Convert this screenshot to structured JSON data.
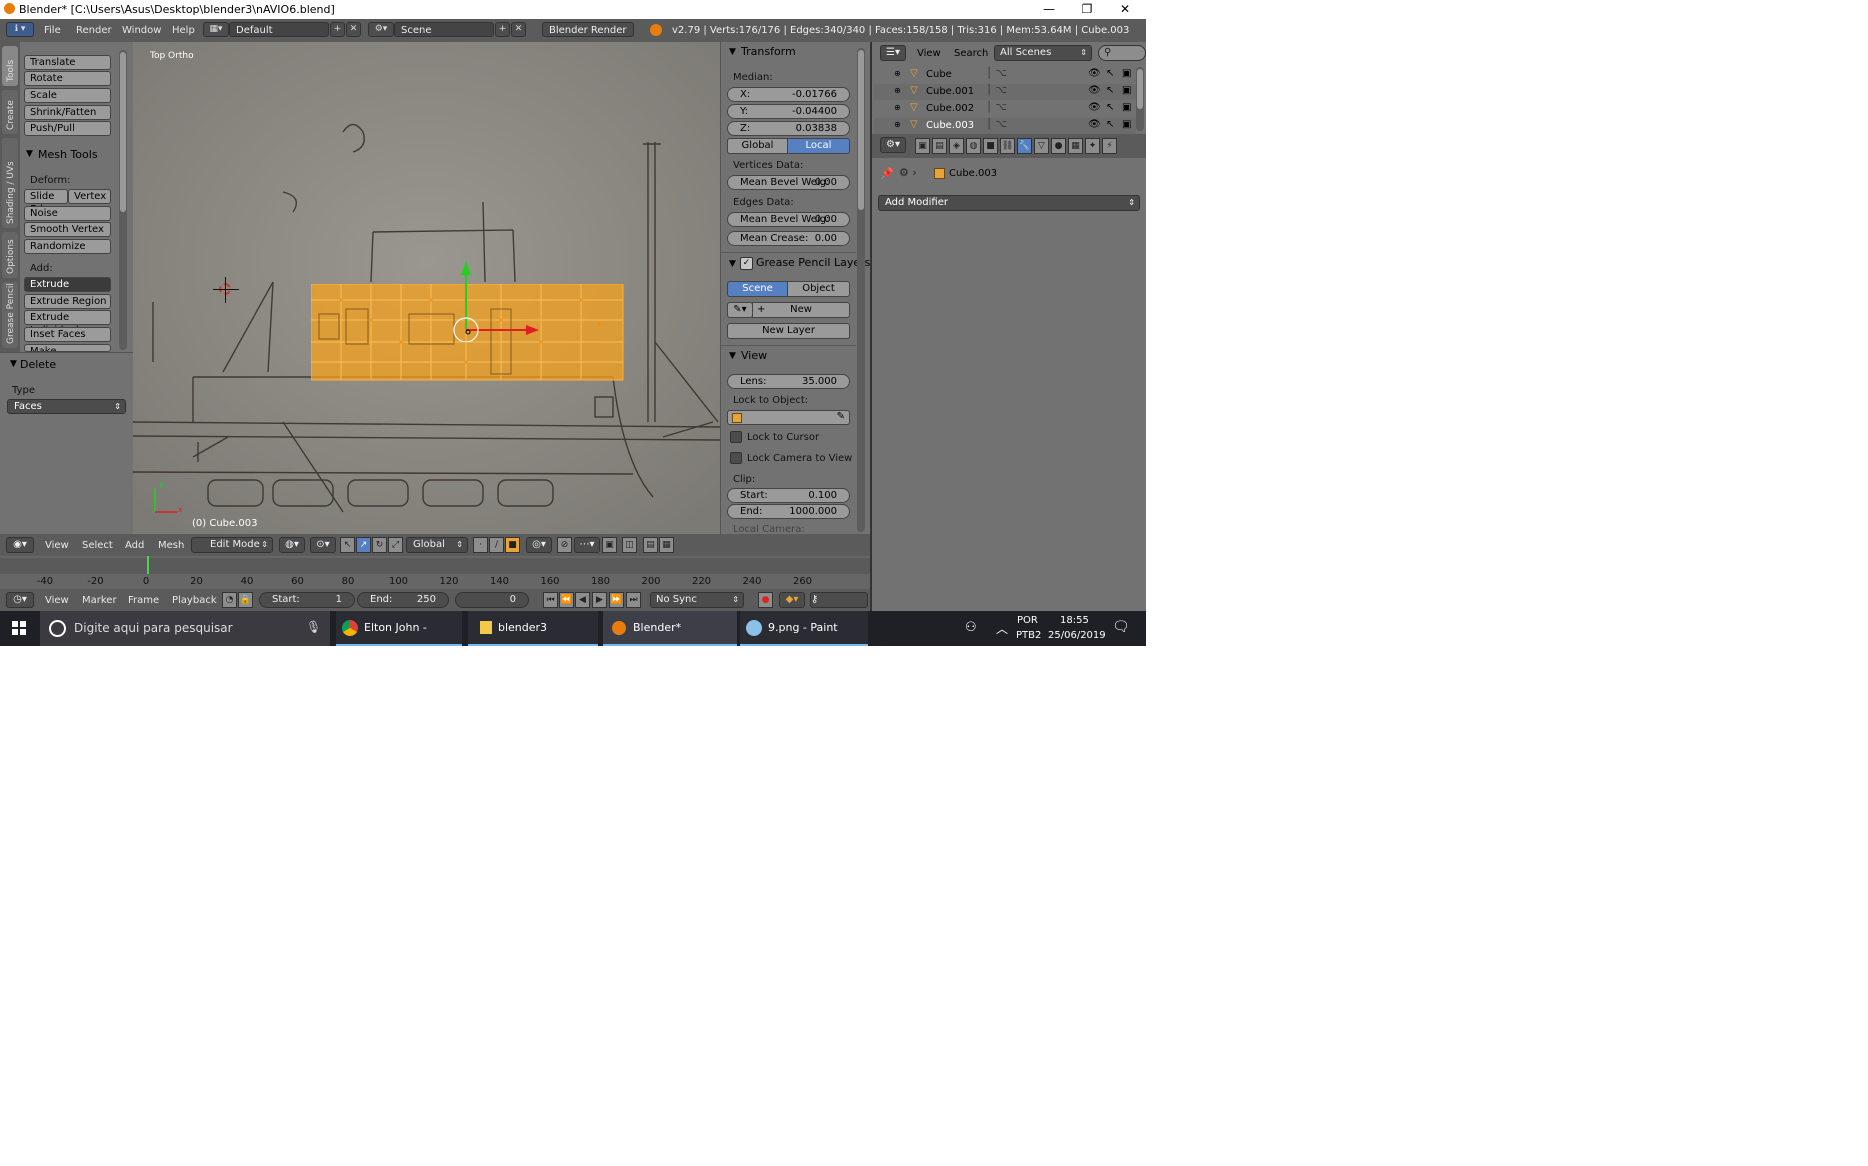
{
  "window": {
    "title": "Blender* [C:\\Users\\Asus\\Desktop\\blender3\\nAVIO6.blend]",
    "minimize": "—",
    "restore": "❐",
    "close": "✕"
  },
  "info_header": {
    "menus": [
      "File",
      "Render",
      "Window",
      "Help"
    ],
    "layout": "Default",
    "scene": "Scene",
    "engine": "Blender Render",
    "stats": "v2.79 | Verts:176/176 | Edges:340/340 | Faces:158/158 | Tris:316 | Mem:53.64M | Cube.003"
  },
  "tool_tabs": [
    "Tools",
    "Create",
    "Shading / UVs",
    "Options",
    "Grease Pencil"
  ],
  "tool_shelf": {
    "transform_buttons": [
      "Translate",
      "Rotate",
      "Scale",
      "Shrink/Fatten",
      "Push/Pull"
    ],
    "mesh_tools_title": "Mesh Tools",
    "deform_label": "Deform:",
    "slide_edge": "Slide Ed",
    "vertex": "Vertex",
    "deform_buttons": [
      "Noise",
      "Smooth Vertex",
      "Randomize"
    ],
    "add_label": "Add:",
    "extrude": "Extrude",
    "add_buttons": [
      "Extrude Region",
      "Extrude Individual",
      "Inset Faces",
      "Make Edge/Face"
    ]
  },
  "operator_panel": {
    "title": "Delete",
    "type_label": "Type",
    "type_value": "Faces"
  },
  "viewport": {
    "view_name": "Top Ortho",
    "object_label": "(0) Cube.003",
    "axis_y": "y",
    "axis_x": "x"
  },
  "n_panel": {
    "transform_title": "Transform",
    "median_label": "Median:",
    "x_label": "X:",
    "x_value": "-0.01766",
    "y_label": "Y:",
    "y_value": "-0.04400",
    "z_label": "Z:",
    "z_value": "0.03838",
    "global": "Global",
    "local": "Local",
    "vertices_data": "Vertices Data:",
    "mean_bevel_v": "Mean Bevel Weig:",
    "mean_bevel_v_value": "0.00",
    "edges_data": "Edges Data:",
    "mean_bevel_e": "Mean Bevel Weig:",
    "mean_bevel_e_value": "0.00",
    "mean_crease": "Mean Crease:",
    "mean_crease_value": "0.00",
    "grease_title": "Grease Pencil Layers",
    "scene_btn": "Scene",
    "object_btn": "Object",
    "new_btn": "New",
    "new_layer_btn": "New Layer",
    "view_title": "View",
    "lens_label": "Lens:",
    "lens_value": "35.000",
    "lock_object_label": "Lock to Object:",
    "lock_cursor": "Lock to Cursor",
    "lock_camera": "Lock Camera to View",
    "clip_label": "Clip:",
    "start_label": "Start:",
    "start_value": "0.100",
    "end_label": "End:",
    "end_value": "1000.000",
    "local_camera": "Local Camera:"
  },
  "view_header": {
    "menus": [
      "View",
      "Select",
      "Add",
      "Mesh"
    ],
    "mode": "Edit Mode",
    "orientation": "Global"
  },
  "timeline": {
    "ticks": [
      "-40",
      "-20",
      "0",
      "20",
      "40",
      "60",
      "80",
      "100",
      "120",
      "140",
      "160",
      "180",
      "200",
      "220",
      "240",
      "260"
    ],
    "current_frame": 0,
    "menus": [
      "View",
      "Marker",
      "Frame",
      "Playback"
    ],
    "start_label": "Start:",
    "start_value": "1",
    "end_label": "End:",
    "end_value": "250",
    "frame_value": "0",
    "sync": "No Sync"
  },
  "outliner": {
    "view": "View",
    "search": "Search",
    "filter": "All Scenes",
    "items": [
      "Cube",
      "Cube.001",
      "Cube.002",
      "Cube.003"
    ]
  },
  "properties": {
    "object_name": "Cube.003",
    "add_modifier": "Add Modifier"
  },
  "taskbar": {
    "search_placeholder": "Digite aqui para pesquisar",
    "apps": [
      "Elton John - Saturd...",
      "blender3",
      "Blender* [C:\\Users\\...",
      "9.png - Paint"
    ],
    "lang1": "POR",
    "lang2": "PTB2",
    "time": "18:55",
    "date": "25/06/2019"
  },
  "colors": {
    "selection": "#f5a11d",
    "blender_bg": "#727272",
    "header": "#5b5b5b",
    "active_blue": "#5680c2"
  }
}
